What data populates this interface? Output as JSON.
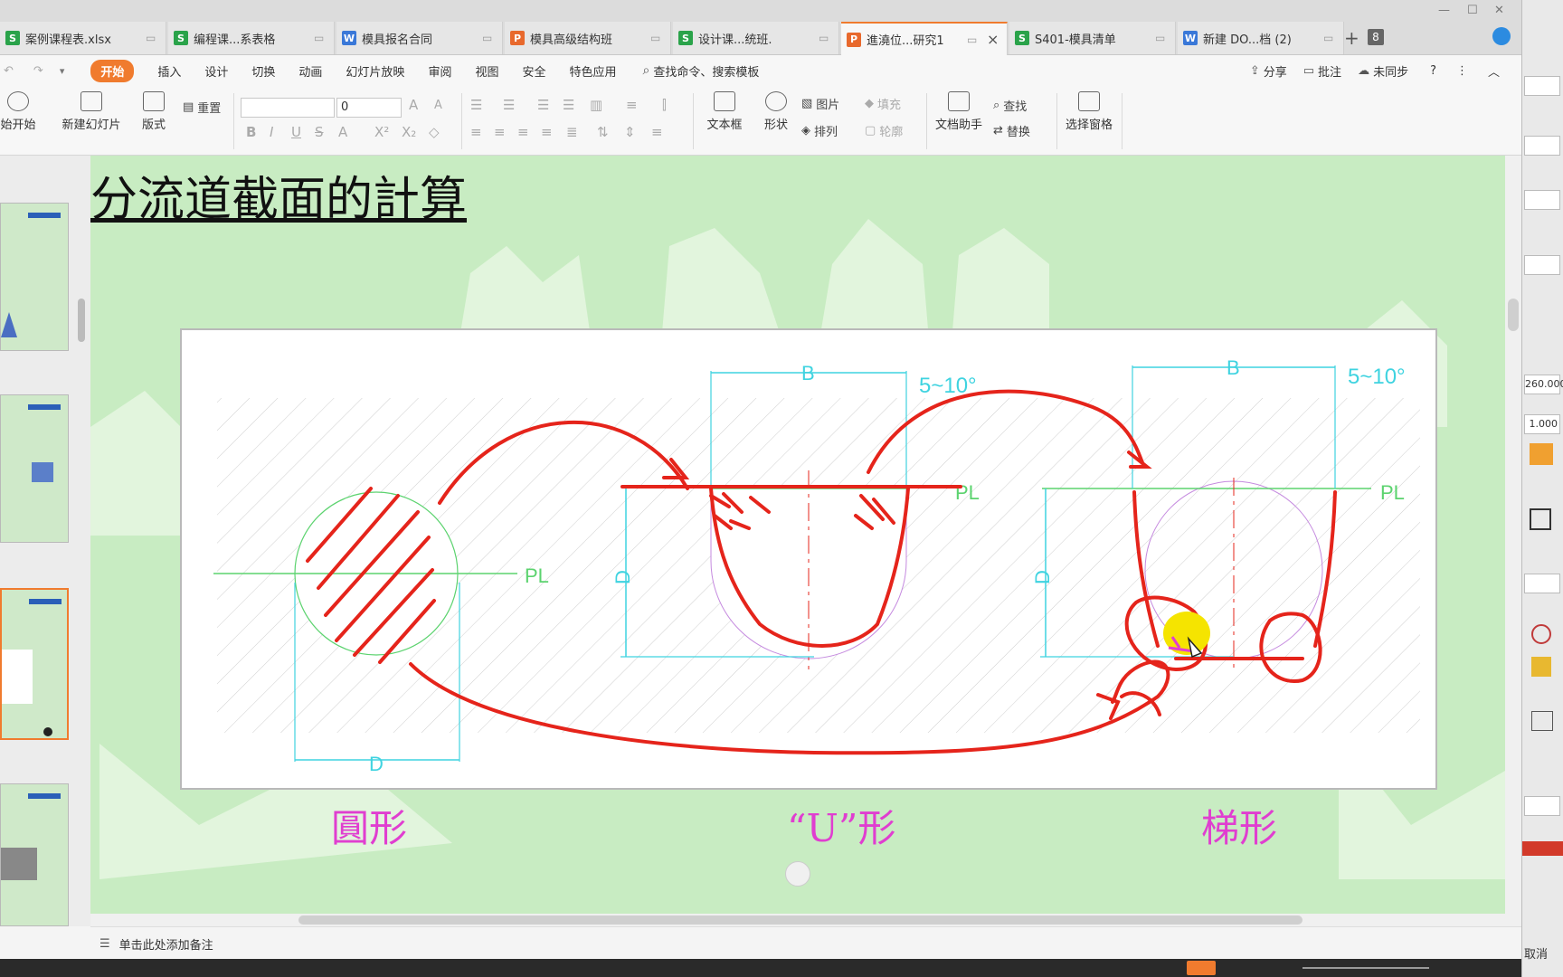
{
  "tabs": [
    {
      "label": "案例课程表.xlsx",
      "type": "S"
    },
    {
      "label": "编程课...系表格",
      "type": "S"
    },
    {
      "label": "模具报名合同",
      "type": "W"
    },
    {
      "label": "模具高级结构班",
      "type": "P"
    },
    {
      "label": "设计课...统班.",
      "type": "S"
    },
    {
      "label": "進澆位...研究1",
      "type": "P",
      "active": true
    },
    {
      "label": "S401-模具清单",
      "type": "S"
    },
    {
      "label": "新建 DO...档 (2)",
      "type": "W"
    }
  ],
  "tab_count": "8",
  "menu": [
    "开始",
    "插入",
    "设计",
    "切换",
    "动画",
    "幻灯片放映",
    "审阅",
    "视图",
    "安全",
    "特色应用"
  ],
  "search_label": "查找命令、搜索模板",
  "menu_right": {
    "share": "分享",
    "comment": "批注",
    "sync": "未同步"
  },
  "ribbon": {
    "start": "始开始",
    "new_slide": "新建幻灯片",
    "layout": "版式",
    "reset": "重置",
    "font_size": "0",
    "textbox": "文本框",
    "shape": "形状",
    "picture": "图片",
    "fill": "填充",
    "arrange": "排列",
    "outline": "轮廓",
    "doc_helper": "文档助手",
    "find": "查找",
    "replace": "替换",
    "select_pane": "选择窗格"
  },
  "slide": {
    "title": "分流道截面的計算",
    "label_circle": "圓形",
    "label_u": "“U”形",
    "label_trap": "梯形",
    "dim_b": "B",
    "dim_d": "D",
    "angle": "5~10°",
    "pl": "PL"
  },
  "notes_placeholder": "单击此处添加备注",
  "right_panel": {
    "value1": "260.000",
    "value2": "1.000",
    "cancel": "取消"
  },
  "colors": {
    "accent": "#f07b2e",
    "slide_bg": "#c8ecc2",
    "annotation": "#e5241b",
    "label": "#e03ed0",
    "cad": "#3fd3e0"
  }
}
